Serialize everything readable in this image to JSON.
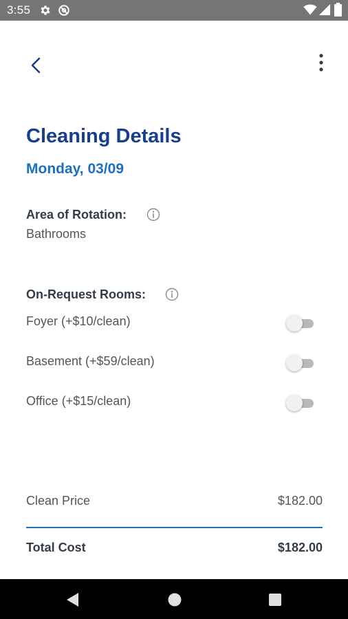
{
  "status_bar": {
    "time": "3:55",
    "icons": [
      "settings-icon",
      "vpn-icon",
      "wifi-icon",
      "signal-icon",
      "battery-icon"
    ]
  },
  "toolbar": {
    "back_icon": "chevron-left-icon",
    "menu_icon": "more-vertical-icon"
  },
  "header": {
    "title": "Cleaning Details",
    "date": "Monday, 03/09"
  },
  "rotation": {
    "label": "Area of Rotation:",
    "value": "Bathrooms",
    "info_icon": "info-icon"
  },
  "on_request": {
    "label": "On-Request Rooms:",
    "info_icon": "info-icon",
    "rooms": [
      {
        "label": "Foyer (+$10/clean)",
        "enabled": false
      },
      {
        "label": "Basement (+$59/clean)",
        "enabled": false
      },
      {
        "label": "Office (+$15/clean)",
        "enabled": false
      }
    ]
  },
  "summary": {
    "clean_price_label": "Clean Price",
    "clean_price_value": "$182.00",
    "total_label": "Total Cost",
    "total_value": "$182.00"
  },
  "colors": {
    "title": "#173f8c",
    "accent": "#1c6fc2",
    "status_bar": "#757575",
    "nav_bar": "#000000"
  },
  "nav_bar": {
    "icons": [
      "nav-back-icon",
      "nav-home-icon",
      "nav-recents-icon"
    ]
  }
}
